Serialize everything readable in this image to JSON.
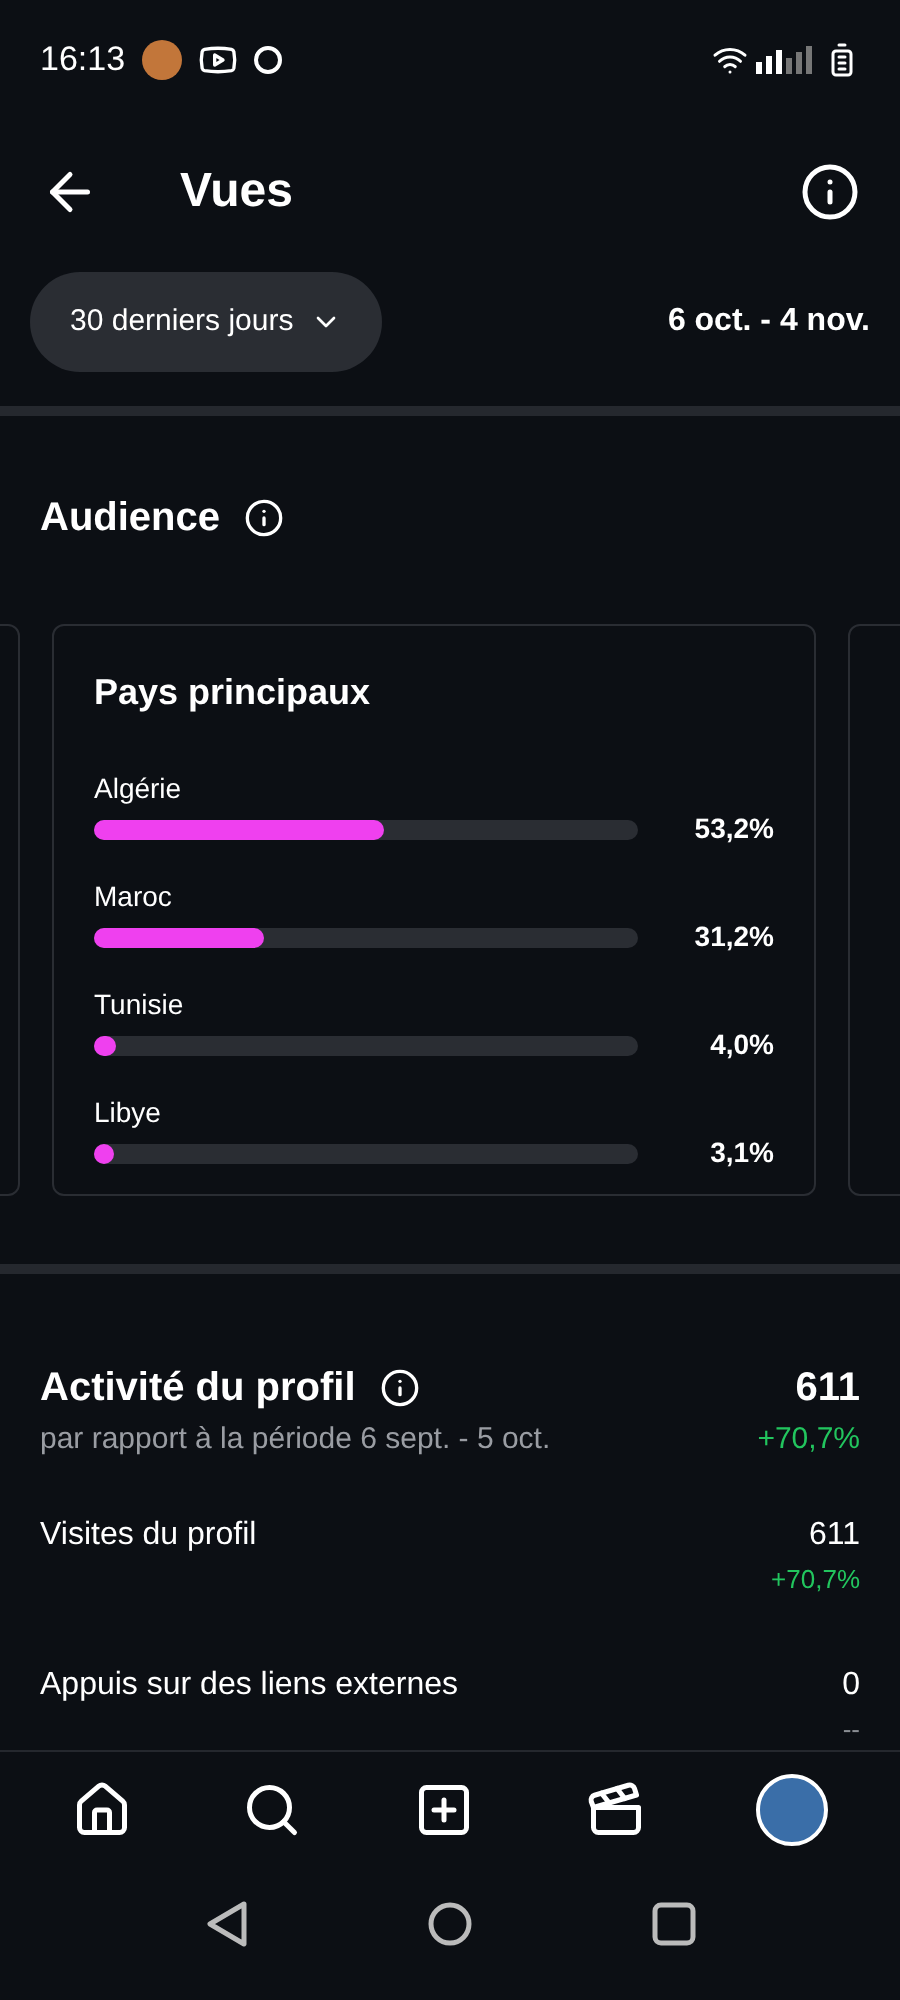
{
  "status_bar": {
    "time": "16:13"
  },
  "header": {
    "title": "Vues"
  },
  "filter": {
    "period": "30 derniers jours",
    "range": "6 oct. - 4 nov."
  },
  "audience": {
    "title": "Audience",
    "card": {
      "title": "Pays principaux",
      "rows": [
        {
          "label": "Algérie",
          "level": 0.532,
          "reading": "53,2%"
        },
        {
          "label": "Maroc",
          "level": 0.312,
          "reading": "31,2%"
        },
        {
          "label": "Tunisie",
          "level": 0.04,
          "reading": "4,0%"
        },
        {
          "label": "Libye",
          "level": 0.031,
          "reading": "3,1%"
        }
      ]
    }
  },
  "activity": {
    "title": "Activité du profil",
    "subtitle": "par rapport à la période 6 sept. - 5 oct.",
    "total": "611",
    "change": "+70,7%",
    "rows": [
      {
        "label": "Visites du profil",
        "value": "611",
        "change": "+70,7%",
        "color": "#22c55e"
      },
      {
        "label": "Appuis sur des liens externes",
        "value": "0",
        "change": "--",
        "color": "#8a8d93"
      }
    ]
  }
}
